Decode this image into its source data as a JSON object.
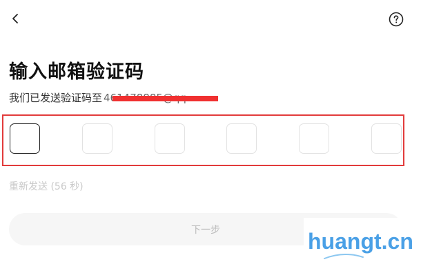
{
  "page": {
    "title": "输入邮箱验证码",
    "subtitle_prefix": "我们已发送验证码至",
    "email_masked": "461478885@qq"
  },
  "code_input": {
    "length": 6,
    "active_index": 0
  },
  "resend": {
    "label": "重新发送 (56 秒)"
  },
  "next_button": {
    "label": "下一步"
  },
  "watermark": {
    "text": "huangt.cn"
  },
  "icons": {
    "back": "chevron-left-icon",
    "help": "question-circle-icon"
  },
  "colors": {
    "highlight_frame": "#e23b3b",
    "redaction": "#f03030",
    "disabled_text": "#c9c9c9",
    "watermark": "#4aa0e6"
  }
}
